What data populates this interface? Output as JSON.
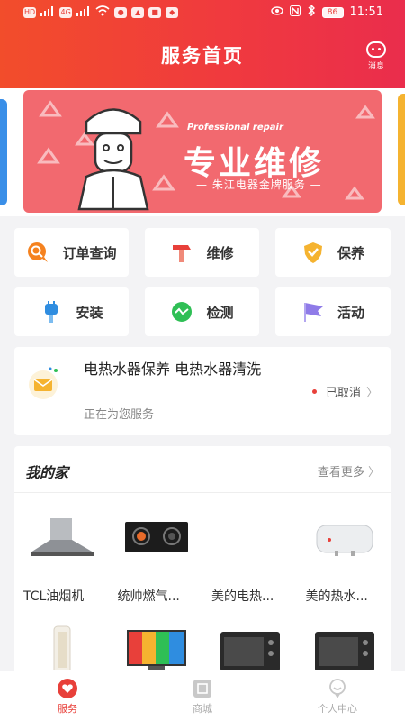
{
  "status_bar": {
    "left_chips": [
      "HD",
      "4G",
      "HD",
      "4G"
    ],
    "time": "11:51",
    "battery": "86"
  },
  "header": {
    "title": "服务首页",
    "message_label": "消息"
  },
  "banner": {
    "subtitle": "Professional repair",
    "headline": "专业维修",
    "tagline": "— 朱江电器金牌服务 —"
  },
  "services": [
    {
      "label": "订单查询",
      "icon": "search-bubble-icon",
      "color": "#f5821f"
    },
    {
      "label": "维修",
      "icon": "hammer-icon",
      "color": "#e8403a"
    },
    {
      "label": "保养",
      "icon": "shield-icon",
      "color": "#f5b330"
    },
    {
      "label": "安装",
      "icon": "plug-icon",
      "color": "#2f8de0"
    },
    {
      "label": "检测",
      "icon": "pulse-icon",
      "color": "#2fbf55"
    },
    {
      "label": "活动",
      "icon": "flag-icon",
      "color": "#8f7be8"
    }
  ],
  "order": {
    "title": "电热水器保养 电热水器清洗",
    "subtitle": "正在为您服务",
    "status": "已取消"
  },
  "my_home": {
    "title": "我的家",
    "more": "查看更多",
    "appliances": [
      {
        "name": "TCL油烟机",
        "icon": "range-hood-icon"
      },
      {
        "name": "统帅燃气...",
        "icon": "gas-stove-icon"
      },
      {
        "name": "美的电热...",
        "icon": "blank"
      },
      {
        "name": "美的热水...",
        "icon": "water-heater-icon"
      }
    ],
    "appliances_row2": [
      {
        "icon": "air-conditioner-icon"
      },
      {
        "icon": "television-icon"
      },
      {
        "icon": "oven-icon"
      },
      {
        "icon": "oven-icon"
      }
    ]
  },
  "tabbar": [
    {
      "label": "服务",
      "icon": "heart-icon",
      "active": true
    },
    {
      "label": "商城",
      "icon": "shop-icon",
      "active": false
    },
    {
      "label": "个人中心",
      "icon": "profile-icon",
      "active": false
    }
  ]
}
